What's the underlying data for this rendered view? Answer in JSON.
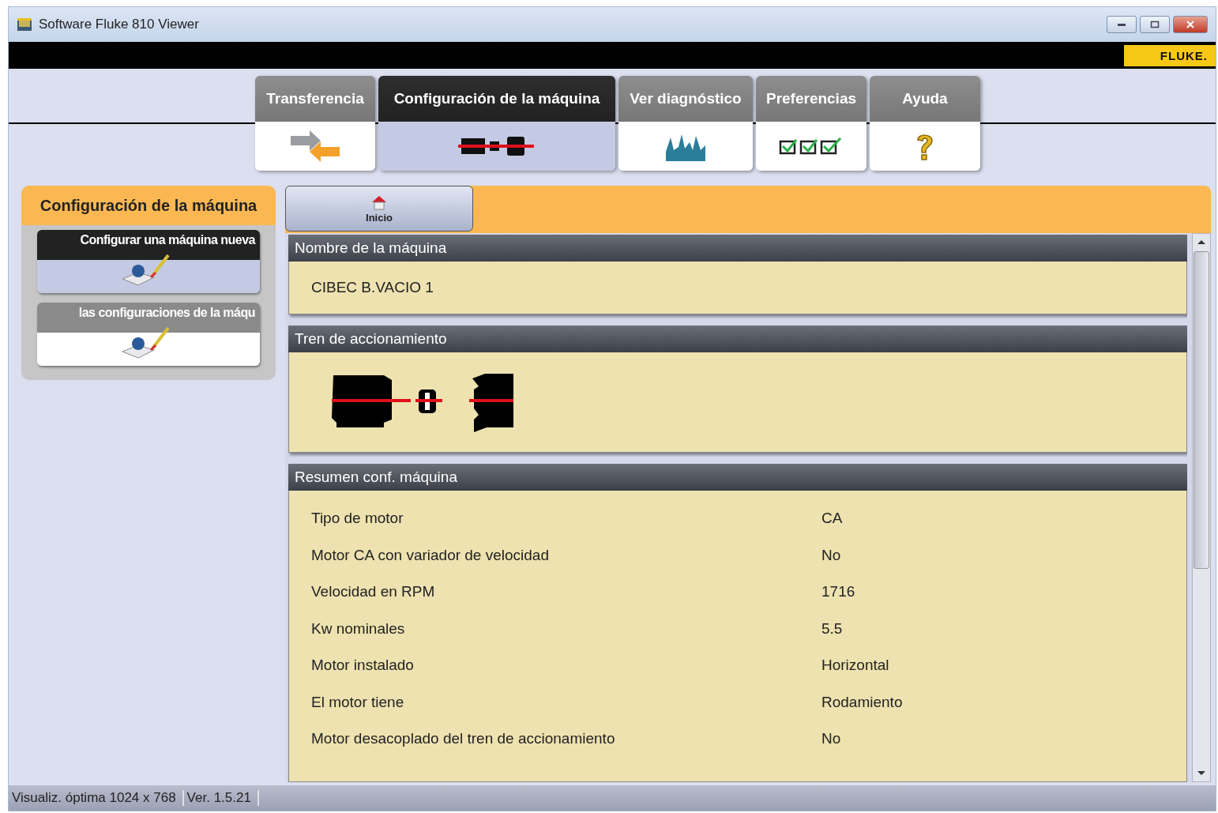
{
  "window": {
    "title": "Software Fluke 810 Viewer",
    "logo": "FLUKE."
  },
  "tabs": [
    {
      "label": "Transferencia",
      "kind": "transfer",
      "selected": false
    },
    {
      "label": "Configuración de la máquina",
      "kind": "machine",
      "selected": true
    },
    {
      "label": "Ver diagnóstico",
      "kind": "spectrum",
      "selected": false
    },
    {
      "label": "Preferencias",
      "kind": "checks",
      "selected": false
    },
    {
      "label": "Ayuda",
      "kind": "help",
      "selected": false
    }
  ],
  "sidebar": {
    "title": "Configuración de la máquina",
    "items": [
      {
        "label": "Configurar una máquina nueva",
        "selected": true
      },
      {
        "label": "las configuraciones de la máqu",
        "selected": false
      }
    ]
  },
  "home_button": {
    "label": "Inicio"
  },
  "sections": [
    {
      "title": "Nombre de la máquina",
      "kind": "text",
      "value": "CIBEC B.VACIO 1"
    },
    {
      "title": "Tren de accionamiento",
      "kind": "drivetrain"
    },
    {
      "title": "Resumen conf. máquina",
      "kind": "table",
      "rows": [
        {
          "label": "Tipo de motor",
          "value": "CA"
        },
        {
          "label": "Motor CA con variador de velocidad",
          "value": "No"
        },
        {
          "label": "Velocidad en RPM",
          "value": "1716"
        },
        {
          "label": "Kw nominales",
          "value": "5.5"
        },
        {
          "label": "Motor instalado",
          "value": "Horizontal"
        },
        {
          "label": "El motor tiene",
          "value": "Rodamiento"
        },
        {
          "label": "Motor desacoplado del tren de accionamiento",
          "value": "No"
        }
      ]
    }
  ],
  "status_bar": [
    "Visualiz. óptima 1024 x 768",
    "Ver. 1.5.21"
  ]
}
